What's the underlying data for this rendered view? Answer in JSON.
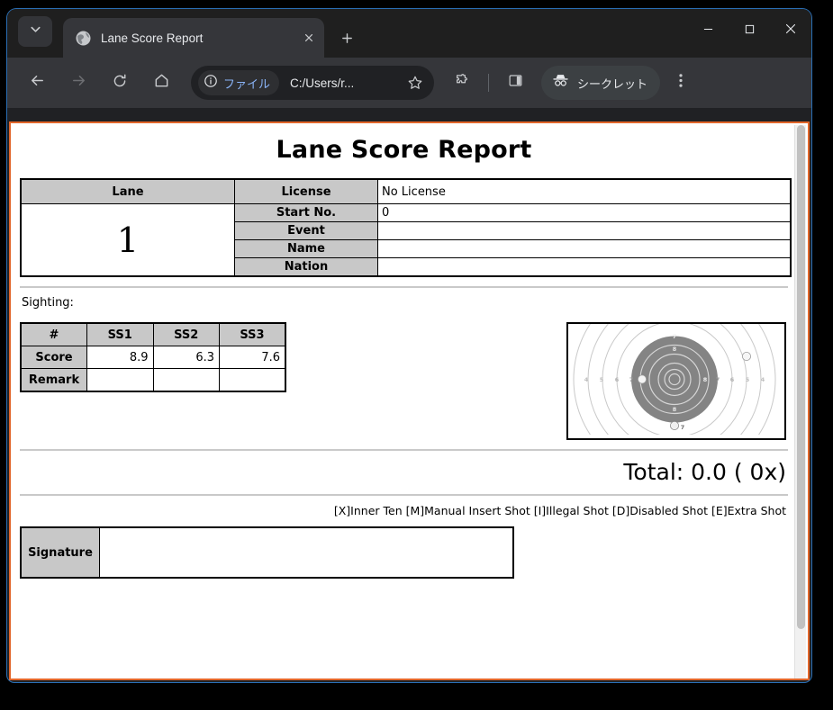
{
  "browser": {
    "tab_search_icon": "chevron-down-icon",
    "tabs": [
      {
        "title": "Lane Score Report",
        "favicon": "globe-icon",
        "close_icon": "close-icon"
      }
    ],
    "new_tab_label": "+",
    "window_controls": {
      "minimize": "minimize-icon",
      "maximize": "maximize-icon",
      "close": "close-icon"
    },
    "toolbar": {
      "back_icon": "back-arrow-icon",
      "forward_icon": "forward-arrow-icon",
      "reload_icon": "reload-icon",
      "home_icon": "home-icon",
      "file_chip_label": "ファイル",
      "file_chip_icon": "info-circle-icon",
      "url": "C:/Users/r...",
      "bookmark_icon": "star-icon",
      "extensions_icon": "puzzle-piece-icon",
      "side_panel_icon": "side-panel-icon",
      "incognito_icon": "incognito-hat-icon",
      "incognito_label": "シークレット",
      "menu_icon": "three-dot-menu-icon"
    }
  },
  "page": {
    "title": "Lane Score Report",
    "info_table": {
      "lane_header": "Lane",
      "lane_number": "1",
      "fields": [
        {
          "label": "License",
          "value": "No License"
        },
        {
          "label": "Start No.",
          "value": "0"
        },
        {
          "label": "Event",
          "value": ""
        },
        {
          "label": "Name",
          "value": ""
        },
        {
          "label": "Nation",
          "value": ""
        }
      ]
    },
    "sighting_label": "Sighting:",
    "sighting_table": {
      "columns": [
        "#",
        "SS1",
        "SS2",
        "SS3"
      ],
      "rows": [
        {
          "label": "Score",
          "values": [
            "8.9",
            "6.3",
            "7.6"
          ]
        },
        {
          "label": "Remark",
          "values": [
            "",
            "",
            ""
          ]
        }
      ]
    },
    "target": {
      "name": "shooting-target-graphic",
      "ring_labels_left": [
        "4",
        "5",
        "6",
        "7"
      ],
      "ring_labels_right": [
        "7",
        "6",
        "5",
        "4"
      ],
      "ring_label_top": "7",
      "ring_label_top_inner": "8",
      "ring_label_bottom_inner": "8",
      "ring_label_bottom": "7",
      "ring_label_inner_left": "8",
      "ring_label_inner_right": "8",
      "dark_ring_color": "#808080",
      "line_color": "#bdbdbd"
    },
    "total_text": "Total: 0.0 ( 0x)",
    "legend_text": "[X]Inner Ten [M]Manual Insert Shot [I]Illegal Shot [D]Disabled Shot [E]Extra Shot",
    "signature_label": "Signature",
    "signature_value": ""
  }
}
